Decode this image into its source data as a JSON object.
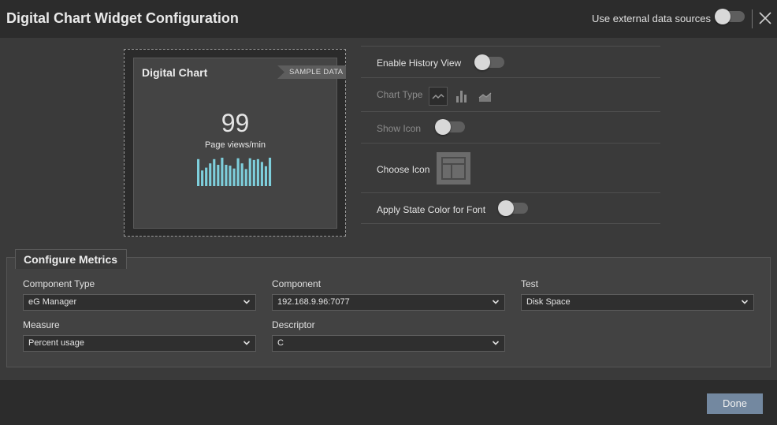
{
  "header": {
    "title": "Digital Chart Widget Configuration",
    "external_label": "Use external data sources",
    "external_enabled": false
  },
  "preview": {
    "widget_title": "Digital Chart",
    "ribbon": "SAMPLE DATA",
    "value": "99",
    "value_label": "Page views/min",
    "bar_color": "#7ecfdc",
    "bars": [
      0.95,
      0.55,
      0.65,
      0.8,
      0.95,
      0.75,
      1.0,
      0.75,
      0.72,
      0.62,
      0.98,
      0.8,
      0.6,
      0.98,
      0.92,
      0.95,
      0.85,
      0.7,
      1.0
    ]
  },
  "settings": {
    "history_label": "Enable History View",
    "history_enabled": false,
    "chart_type_label": "Chart Type",
    "chart_types": [
      "line-chart-icon",
      "bar-chart-icon",
      "area-chart-icon"
    ],
    "selected_chart_type": "line-chart-icon",
    "show_icon_label": "Show Icon",
    "show_icon_enabled": false,
    "choose_icon_label": "Choose Icon",
    "chosen_icon": "layout-icon",
    "state_color_label": "Apply State Color for Font",
    "state_color_enabled": false
  },
  "metrics": {
    "heading": "Configure Metrics",
    "component_type_label": "Component Type",
    "component_type_value": "eG Manager",
    "component_label": "Component",
    "component_value": "192.168.9.96:7077",
    "test_label": "Test",
    "test_value": "Disk Space",
    "measure_label": "Measure",
    "measure_value": "Percent usage",
    "descriptor_label": "Descriptor",
    "descriptor_value": "C"
  },
  "footer": {
    "done_label": "Done",
    "accent_color": "#7388a0"
  }
}
